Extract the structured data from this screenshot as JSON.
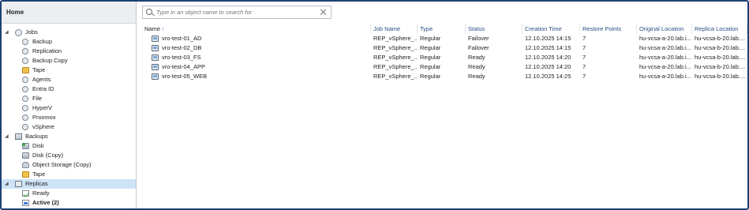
{
  "nav": {
    "header": "Home",
    "tree": [
      {
        "label": "Jobs",
        "level": 0,
        "toggle": "◢",
        "icon": "jobs-gear-icon"
      },
      {
        "label": "Backup",
        "level": 1,
        "icon": "gear-icon"
      },
      {
        "label": "Replication",
        "level": 1,
        "icon": "gear-icon"
      },
      {
        "label": "Backup Copy",
        "level": 1,
        "icon": "gear-icon"
      },
      {
        "label": "Tape",
        "level": 1,
        "icon": "tape-icon"
      },
      {
        "label": "Agents",
        "level": 1,
        "icon": "gear-icon"
      },
      {
        "label": "Entra ID",
        "level": 1,
        "icon": "gear-icon"
      },
      {
        "label": "File",
        "level": 1,
        "icon": "gear-icon"
      },
      {
        "label": "HyperV",
        "level": 1,
        "icon": "gear-icon"
      },
      {
        "label": "Proxmox",
        "level": 1,
        "icon": "gear-icon"
      },
      {
        "label": "vSphere",
        "level": 1,
        "icon": "gear-icon"
      },
      {
        "label": "Backups",
        "level": 0,
        "toggle": "◢",
        "icon": "backups-icon"
      },
      {
        "label": "Disk",
        "level": 1,
        "icon": "disk-icon"
      },
      {
        "label": "Disk (Copy)",
        "level": 1,
        "icon": "disk-copy-icon"
      },
      {
        "label": "Object Storage (Copy)",
        "level": 1,
        "icon": "object-storage-icon"
      },
      {
        "label": "Tape",
        "level": 1,
        "icon": "tape-icon"
      },
      {
        "label": "Replicas",
        "level": 0,
        "toggle": "◢",
        "icon": "replicas-icon",
        "selected": true
      },
      {
        "label": "Ready",
        "level": 1,
        "icon": "ready-icon"
      },
      {
        "label": "Active (2)",
        "level": 1,
        "icon": "active-icon",
        "bold": true
      }
    ]
  },
  "search": {
    "placeholder": "Type in an object name to search for",
    "value": ""
  },
  "table": {
    "columns": [
      "Name",
      "Job Name",
      "Type",
      "Status",
      "Creation Time",
      "Restore Points",
      "Original Location",
      "Replica Location"
    ],
    "sort_indicator": "↑",
    "rows": [
      [
        "vro-test-01_AD",
        "REP_vSphere_...",
        "Regular",
        "Failover",
        "12.10.2025 14:15",
        "7",
        "hu-vcsa-a-20.lab.i...",
        "hu-vcsa-b-20.lab...."
      ],
      [
        "vro-test-02_DB",
        "REP_vSphere_...",
        "Regular",
        "Failover",
        "12.10.2025 14:15",
        "7",
        "hu-vcsa-a-20.lab.i...",
        "hu-vcsa-b-20.lab...."
      ],
      [
        "vro-test-03_FS",
        "REP_vSphere_...",
        "Regular",
        "Ready",
        "12.10.2025 14:20",
        "7",
        "hu-vcsa-a-20.lab.i...",
        "hu-vcsa-b-20.lab...."
      ],
      [
        "vro-test-04_APP",
        "REP_vSphere_...",
        "Regular",
        "Ready",
        "12.10.2025 14:20",
        "7",
        "hu-vcsa-a-20.lab.i...",
        "hu-vcsa-b-20.lab...."
      ],
      [
        "vro-test-05_WEB",
        "REP_vSphere_...",
        "Regular",
        "Ready",
        "12.10.2025 14:25",
        "7",
        "hu-vcsa-a-20.lab.i...",
        "hu-vcsa-b-20.lab...."
      ]
    ]
  },
  "colors": {
    "frame_border": "#1f3f73",
    "selection": "#cfe3f7",
    "header_text": "#2a4f86"
  }
}
